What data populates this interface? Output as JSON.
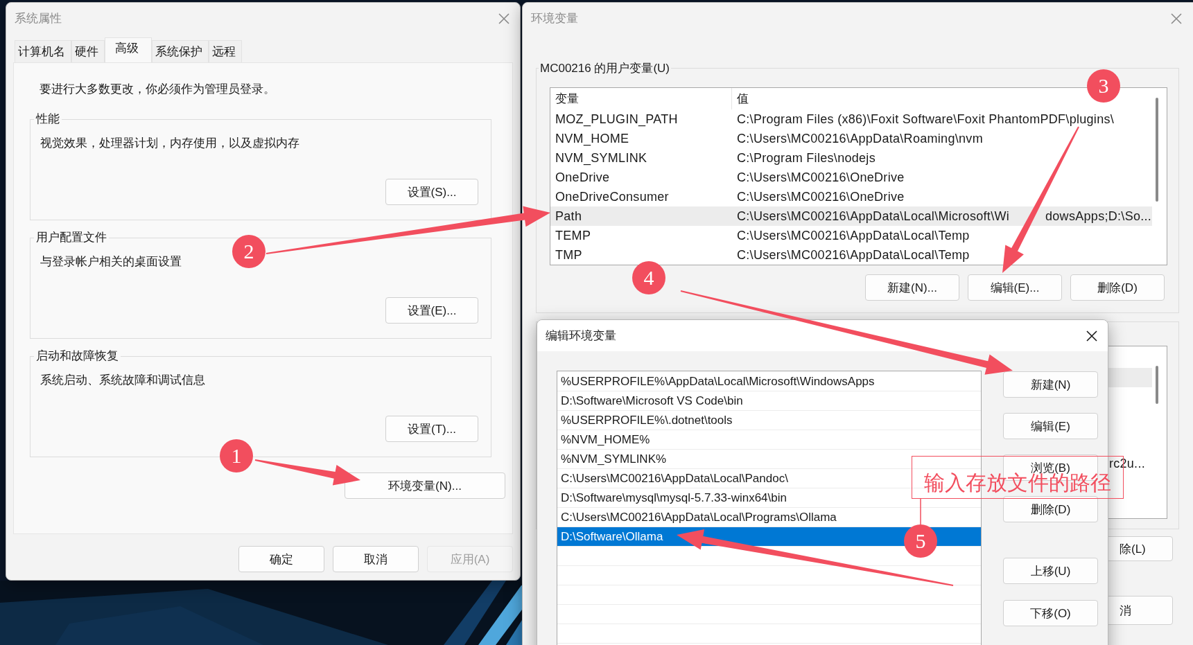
{
  "system_properties": {
    "title": "系统属性",
    "tabs": [
      {
        "label": "计算机名",
        "selected": false
      },
      {
        "label": "硬件",
        "selected": false
      },
      {
        "label": "高级",
        "selected": true
      },
      {
        "label": "系统保护",
        "selected": false
      },
      {
        "label": "远程",
        "selected": false
      }
    ],
    "admin_note": "要进行大多数更改，你必须作为管理员登录。",
    "groups": [
      {
        "title": "性能",
        "description": "视觉效果，处理器计划，内存使用，以及虚拟内存",
        "button": "设置(S)..."
      },
      {
        "title": "用户配置文件",
        "description": "与登录帐户相关的桌面设置",
        "button": "设置(E)..."
      },
      {
        "title": "启动和故障恢复",
        "description": "系统启动、系统故障和调试信息",
        "button": "设置(T)..."
      }
    ],
    "env_button": "环境变量(N)...",
    "buttons": [
      {
        "label": "确定",
        "disabled": false
      },
      {
        "label": "取消",
        "disabled": false
      },
      {
        "label": "应用(A)",
        "disabled": true
      }
    ]
  },
  "environment_variables": {
    "title": "环境变量",
    "user_group": {
      "title": "MC00216 的用户变量(U)",
      "columns": [
        "变量",
        "值"
      ],
      "rows": [
        {
          "name": "MOZ_PLUGIN_PATH",
          "value": "C:\\Program Files (x86)\\Foxit Software\\Foxit PhantomPDF\\plugins\\",
          "selected": false
        },
        {
          "name": "NVM_HOME",
          "value": "C:\\Users\\MC00216\\AppData\\Roaming\\nvm",
          "selected": false
        },
        {
          "name": "NVM_SYMLINK",
          "value": "C:\\Program Files\\nodejs",
          "selected": false
        },
        {
          "name": "OneDrive",
          "value": "C:\\Users\\MC00216\\OneDrive",
          "selected": false
        },
        {
          "name": "OneDriveConsumer",
          "value": "C:\\Users\\MC00216\\OneDrive",
          "selected": false
        },
        {
          "name": "Path",
          "value": "C:\\Users\\MC00216\\AppData\\Local\\Microsoft\\Wi",
          "value_after_arrow": "dowsApps;D:\\So...",
          "selected": true
        },
        {
          "name": "TEMP",
          "value": "C:\\Users\\MC00216\\AppData\\Local\\Temp",
          "selected": false
        },
        {
          "name": "TMP",
          "value": "C:\\Users\\MC00216\\AppData\\Local\\Temp",
          "selected": false
        }
      ],
      "buttons": [
        "新建(N)...",
        "编辑(E)...",
        "删除(D)"
      ]
    },
    "system_group": {
      "row_text": "rc2u...",
      "buttons": [
        "除(L)",
        "消"
      ]
    }
  },
  "edit_dialog": {
    "title": "编辑环境变量",
    "entries": [
      {
        "text": "%USERPROFILE%\\AppData\\Local\\Microsoft\\WindowsApps",
        "selected": false
      },
      {
        "text": "D:\\Software\\Microsoft VS Code\\bin",
        "selected": false
      },
      {
        "text": "%USERPROFILE%\\.dotnet\\tools",
        "selected": false
      },
      {
        "text": "%NVM_HOME%",
        "selected": false
      },
      {
        "text": "%NVM_SYMLINK%",
        "selected": false
      },
      {
        "text": "C:\\Users\\MC00216\\AppData\\Local\\Pandoc\\",
        "selected": false
      },
      {
        "text": "D:\\Software\\mysql\\mysql-5.7.33-winx64\\bin",
        "selected": false
      },
      {
        "text": "C:\\Users\\MC00216\\AppData\\Local\\Programs\\Ollama",
        "selected": false
      },
      {
        "text": "D:\\Software\\Ollama",
        "selected": true
      }
    ],
    "buttons": [
      "新建(N)",
      "编辑(E)",
      "浏览(B)",
      "删除(D)",
      "上移(U)",
      "下移(O)"
    ]
  },
  "annotations": {
    "markers": [
      "1",
      "2",
      "3",
      "4",
      "5"
    ],
    "note": "输入存放文件的路径"
  }
}
